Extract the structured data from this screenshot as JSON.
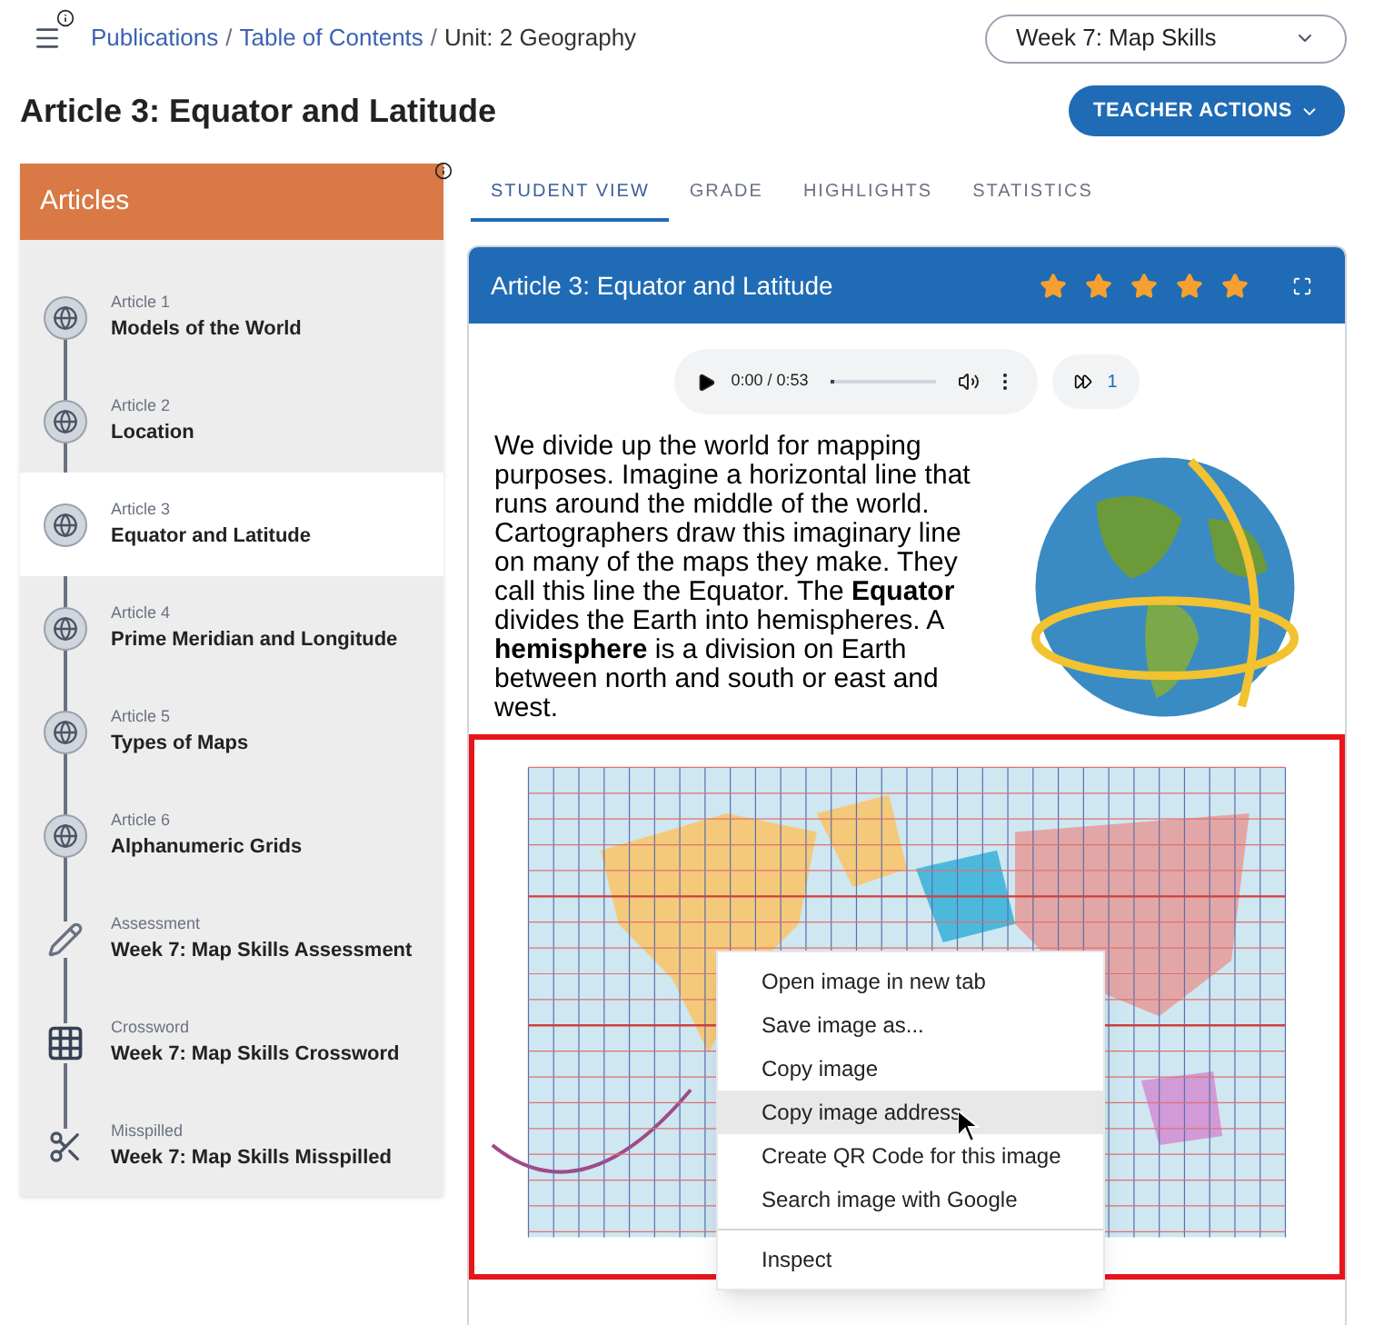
{
  "breadcrumb": [
    {
      "label": "Publications",
      "link": true
    },
    {
      "separator": "/",
      "label": "Table of Contents",
      "link": true
    },
    {
      "separator": "/",
      "label": "Unit: 2 Geography",
      "link": false
    }
  ],
  "week_select": {
    "value": "Week 7: Map Skills"
  },
  "page_title": "Article 3: Equator and Latitude",
  "teacher_button": "TEACHER ACTIONS",
  "sidebar": {
    "title": "Articles",
    "items": [
      {
        "kind": "article",
        "caption": "Article 1",
        "title": "Models of the World",
        "selected": false
      },
      {
        "kind": "article",
        "caption": "Article 2",
        "title": "Location",
        "selected": false
      },
      {
        "kind": "article",
        "caption": "Article 3",
        "title": "Equator and Latitude",
        "selected": true
      },
      {
        "kind": "article",
        "caption": "Article 4",
        "title": "Prime Meridian and Longitude",
        "selected": false
      },
      {
        "kind": "article",
        "caption": "Article 5",
        "title": "Types of Maps",
        "selected": false
      },
      {
        "kind": "article",
        "caption": "Article 6",
        "title": "Alphanumeric Grids",
        "selected": false
      },
      {
        "kind": "assessment",
        "caption": "Assessment",
        "title": "Week 7: Map Skills Assessment",
        "selected": false
      },
      {
        "kind": "crossword",
        "caption": "Crossword",
        "title": "Week 7: Map Skills Crossword",
        "selected": false
      },
      {
        "kind": "misspilled",
        "caption": "Misspilled",
        "title": "Week 7: Map Skills Misspilled",
        "selected": false
      }
    ]
  },
  "tabs": [
    {
      "label": "STUDENT VIEW",
      "selected": true
    },
    {
      "label": "GRADE",
      "selected": false
    },
    {
      "label": "HIGHLIGHTS",
      "selected": false
    },
    {
      "label": "STATISTICS",
      "selected": false
    }
  ],
  "card": {
    "title": "Article 3: Equator and Latitude",
    "stars": 5,
    "audio": {
      "time": "0:00 / 0:53",
      "level": 0.04,
      "speed": "1"
    },
    "paragraph": "We divide up the world for mapping purposes. Imagine a horizontal line that runs around the middle of the world. Cartographers draw this imaginary line on many of the maps they make. They call this line the Equator. The **Equator** divides the Earth into hemispheres. A **hemisphere** is a division on Earth between north and south or east and west."
  },
  "context_menu": [
    {
      "label": "Open image in new tab",
      "selected": false
    },
    {
      "label": "Save image as...",
      "selected": false
    },
    {
      "label": "Copy image",
      "selected": false
    },
    {
      "label": "Copy image address",
      "selected": true
    },
    {
      "label": "Create QR Code for this image",
      "selected": false
    },
    {
      "label": "Search image with Google",
      "selected": false
    },
    {
      "label": "Inspect",
      "selected": false,
      "separated": true
    }
  ]
}
